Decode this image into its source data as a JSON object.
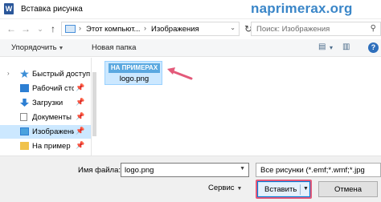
{
  "window": {
    "title": "Вставка рисунка",
    "app_icon_letter": "W",
    "watermark": "naprimerax.org"
  },
  "nav": {
    "back": "←",
    "forward": "→",
    "history": "⌄",
    "up": "↑",
    "breadcrumb": [
      "Этот компьют...",
      "Изображения"
    ],
    "chevron": "›",
    "address_dropdown": "⌄",
    "refresh": "↻",
    "search_placeholder": "Поиск: Изображения",
    "search_icon": "⚲"
  },
  "toolbar": {
    "organize_label": "Упорядочить",
    "new_folder_label": "Новая папка",
    "dropdown_arrow": "▼",
    "view_icon": "▤",
    "view_dropdown": "▾",
    "layout_icon": "▥",
    "help": "?"
  },
  "sidebar": {
    "items": [
      {
        "label": "Быстрый доступ",
        "expander": "›",
        "pin": "",
        "icon_color": "#3d8fd6",
        "selected": false
      },
      {
        "label": "Рабочий сто",
        "expander": "",
        "pin": "📌",
        "icon_color": "#2d7fd3",
        "selected": false
      },
      {
        "label": "Загрузки",
        "expander": "",
        "pin": "📌",
        "icon_color": "#2d7fd3",
        "selected": false
      },
      {
        "label": "Документы",
        "expander": "",
        "pin": "📌",
        "icon_color": "#8a8a8a",
        "selected": false
      },
      {
        "label": "Изображени",
        "expander": "",
        "pin": "📌",
        "icon_color": "#4ba2de",
        "selected": true
      },
      {
        "label": "На пример",
        "expander": "",
        "pin": "📌",
        "icon_color": "#f0c24b",
        "selected": false
      },
      {
        "label": "",
        "expander": "",
        "pin": "",
        "icon_color": "#f0c24b",
        "selected": false
      }
    ]
  },
  "files": [
    {
      "name": "logo.png",
      "thumb_text": "НА ПРИМЕРАХ"
    }
  ],
  "bottom": {
    "filename_label": "Имя файла:",
    "filename_value": "logo.png",
    "filter_value": "Все рисунки (*.emf;*.wmf;*.jpg",
    "service_label": "Сервис",
    "insert_label": "Вставить",
    "cancel_label": "Отмена",
    "dropdown_arrow": "▼"
  },
  "colors": {
    "accent": "#0078d7",
    "selection": "#cce8ff",
    "annotation": "#e35a7a",
    "watermark": "#3a86c8"
  }
}
